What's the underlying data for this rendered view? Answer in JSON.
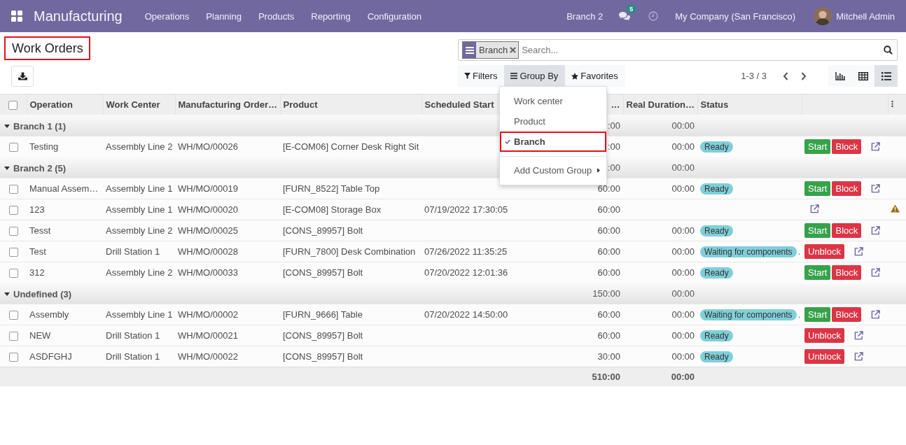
{
  "navbar": {
    "app_name": "Manufacturing",
    "menu": [
      "Operations",
      "Planning",
      "Products",
      "Reporting",
      "Configuration"
    ],
    "branch": "Branch 2",
    "messages_count": "5",
    "company": "My Company (San Francisco)",
    "user": "Mitchell Admin"
  },
  "title": {
    "text": "Work Orders",
    "highlighted": true
  },
  "search": {
    "facet": "Branch",
    "placeholder": "Search..."
  },
  "filters": [
    {
      "label": "Filters",
      "selected": false
    },
    {
      "label": "Group By",
      "selected": true
    },
    {
      "label": "Favorites",
      "selected": false
    }
  ],
  "pager": "1-3 / 3",
  "views": [
    {
      "selected": false
    },
    {
      "selected": false
    },
    {
      "selected": true
    }
  ],
  "groupby_menu": [
    {
      "label": "Work center",
      "checked": false,
      "highlighted": false,
      "kind": "option"
    },
    {
      "label": "Product",
      "checked": false,
      "highlighted": false,
      "kind": "option"
    },
    {
      "label": "Branch",
      "checked": true,
      "highlighted": true,
      "kind": "option"
    },
    {
      "label": "Add Custom Group",
      "checked": false,
      "highlighted": false,
      "kind": "submenu"
    }
  ],
  "table": {
    "all_checked": false,
    "columns": [
      "Operation",
      "Work Center",
      "Manufacturing Order…",
      "Product",
      "Scheduled Start",
      "…",
      "Real Duration…",
      "Status"
    ],
    "groups": [
      {
        "name": "Branch 1 (1)",
        "expanded": true,
        "expected": ":00",
        "real": "00:00",
        "rows": [
          {
            "checked": false,
            "operation": "Testing",
            "work_center": "Assembly Line 2",
            "mo": "WH/MO/00026",
            "product": "[E-COM06] Corner Desk Right Sit",
            "scheduled": "",
            "expected": ":00",
            "real": "00:00",
            "status": "Ready",
            "status_note": "",
            "actions": [
              {
                "label": "Start",
                "kind": "start"
              },
              {
                "label": "Block",
                "kind": "block"
              }
            ],
            "warning": false
          }
        ]
      },
      {
        "name": "Branch 2 (5)",
        "expanded": true,
        "expected": ":00",
        "real": "00:00",
        "rows": [
          {
            "checked": false,
            "operation": "Manual Assem…",
            "work_center": "Assembly Line 1",
            "mo": "WH/MO/00019",
            "product": "[FURN_8522] Table Top",
            "scheduled": "",
            "expected": "60:00",
            "real": "00:00",
            "status": "Ready",
            "status_note": "",
            "actions": [
              {
                "label": "Start",
                "kind": "start"
              },
              {
                "label": "Block",
                "kind": "block"
              }
            ],
            "warning": false
          },
          {
            "checked": false,
            "operation": "123",
            "work_center": "Assembly Line 1",
            "mo": "WH/MO/00020",
            "product": "[E-COM08] Storage Box",
            "scheduled": "07/19/2022 17:30:05",
            "expected": "60:00",
            "real": "",
            "status": "",
            "status_note": "",
            "actions": [],
            "warning": true
          },
          {
            "checked": false,
            "operation": "Tesst",
            "work_center": "Assembly Line 2",
            "mo": "WH/MO/00025",
            "product": "[CONS_89957] Bolt",
            "scheduled": "",
            "expected": "60:00",
            "real": "00:00",
            "status": "Ready",
            "status_note": "",
            "actions": [
              {
                "label": "Start",
                "kind": "start"
              },
              {
                "label": "Block",
                "kind": "block"
              }
            ],
            "warning": false
          },
          {
            "checked": false,
            "operation": "Test",
            "work_center": "Drill Station 1",
            "mo": "WH/MO/00028",
            "product": "[FURN_7800] Desk Combination",
            "scheduled": "07/26/2022 11:35:25",
            "expected": "60:00",
            "real": "00:00",
            "status": "Waiting for components",
            "status_note": ".",
            "actions": [
              {
                "label": "Unblock",
                "kind": "unblock"
              }
            ],
            "warning": false
          },
          {
            "checked": false,
            "operation": "312",
            "work_center": "Assembly Line 2",
            "mo": "WH/MO/00033",
            "product": "[CONS_89957] Bolt",
            "scheduled": "07/20/2022 12:01:36",
            "expected": "60:00",
            "real": "00:00",
            "status": "Ready",
            "status_note": "",
            "actions": [
              {
                "label": "Start",
                "kind": "start"
              },
              {
                "label": "Block",
                "kind": "block"
              }
            ],
            "warning": false
          }
        ]
      },
      {
        "name": "Undefined (3)",
        "expanded": true,
        "expected": "150:00",
        "real": "00:00",
        "rows": [
          {
            "checked": false,
            "operation": "Assembly",
            "work_center": "Assembly Line 1",
            "mo": "WH/MO/00002",
            "product": "[FURN_9666] Table",
            "scheduled": "07/20/2022 14:50:00",
            "expected": "60:00",
            "real": "00:00",
            "status": "Waiting for components",
            "status_note": ".",
            "actions": [
              {
                "label": "Start",
                "kind": "start"
              },
              {
                "label": "Block",
                "kind": "block"
              }
            ],
            "warning": false
          },
          {
            "checked": false,
            "operation": "NEW",
            "work_center": "Drill Station 1",
            "mo": "WH/MO/00021",
            "product": "[CONS_89957] Bolt",
            "scheduled": "",
            "expected": "60:00",
            "real": "00:00",
            "status": "Ready",
            "status_note": "",
            "actions": [
              {
                "label": "Unblock",
                "kind": "unblock"
              }
            ],
            "warning": false
          },
          {
            "checked": false,
            "operation": "ASDFGHJ",
            "work_center": "Drill Station 1",
            "mo": "WH/MO/00022",
            "product": "[CONS_89957] Bolt",
            "scheduled": "",
            "expected": "30:00",
            "real": "00:00",
            "status": "Ready",
            "status_note": "",
            "actions": [
              {
                "label": "Unblock",
                "kind": "unblock"
              }
            ],
            "warning": false
          }
        ]
      }
    ],
    "totals": {
      "expected": "510:00",
      "real": "00:00"
    }
  }
}
